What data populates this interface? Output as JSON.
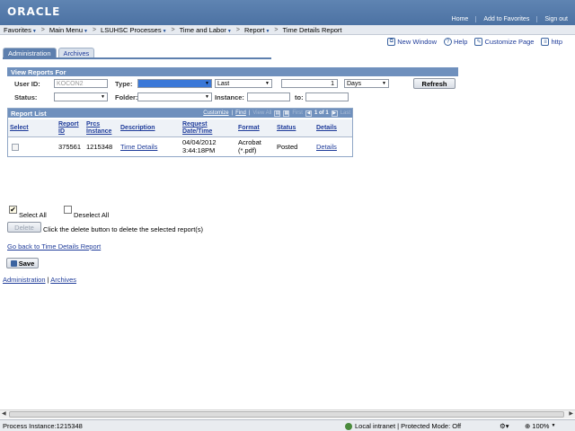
{
  "header": {
    "logo": "ORACLE",
    "links": [
      "Home",
      "Add to Favorites",
      "Sign out"
    ]
  },
  "menubar": {
    "items": [
      "Favorites",
      "Main Menu",
      "LSUHSC Processes",
      "Time and Labor",
      "Report",
      "Time Details Report"
    ],
    "separator": ">"
  },
  "toolbar": {
    "new_window": "New Window",
    "help": "Help",
    "customize_page": "Customize Page",
    "http": "http"
  },
  "tabs": [
    "Administration",
    "Archives"
  ],
  "view_reports": {
    "title": "View Reports For",
    "user_id_label": "User ID:",
    "user_id_value": "KOCON2",
    "type_label": "Type:",
    "type_value": "",
    "last_value": "Last",
    "count_value": "1",
    "period_value": "Days",
    "refresh": "Refresh",
    "status_label": "Status:",
    "status_value": "",
    "folder_label": "Folder:",
    "folder_value": "",
    "instance_label": "Instance:",
    "instance_value": "",
    "to_label": "to:",
    "to_value": ""
  },
  "report_list": {
    "title": "Report List",
    "customize": "Customize",
    "find": "Find",
    "view_all": "View All",
    "first": "First",
    "pager": "1 of 1",
    "last": "Last",
    "columns": {
      "select": "Select",
      "report_id_1": "Report",
      "report_id_2": "ID",
      "prcs_1": "Prcs",
      "prcs_2": "Instance",
      "description": "Description",
      "request_1": "Request",
      "request_2": "Date/Time",
      "format": "Format",
      "status": "Status",
      "details": "Details"
    },
    "rows": [
      {
        "report_id": "375561",
        "prcs_instance": "1215348",
        "description": "Time Details",
        "date": "04/04/2012",
        "time": "3:44:18PM",
        "format_1": "Acrobat",
        "format_2": "(*.pdf)",
        "status": "Posted",
        "details": "Details"
      }
    ]
  },
  "actions": {
    "select_all": "Select All",
    "deselect_all": "Deselect All",
    "delete": "Delete",
    "delete_hint": "Click the delete button to delete the selected report(s)",
    "go_back": "Go back to Time Details Report",
    "save": "Save"
  },
  "footer_links": {
    "administration": "Administration",
    "separator": "|",
    "archives": "Archives"
  },
  "statusbar": {
    "process": "Process Instance:1215348",
    "zone": "Local intranet | Protected Mode: Off",
    "zoom": "100%"
  }
}
